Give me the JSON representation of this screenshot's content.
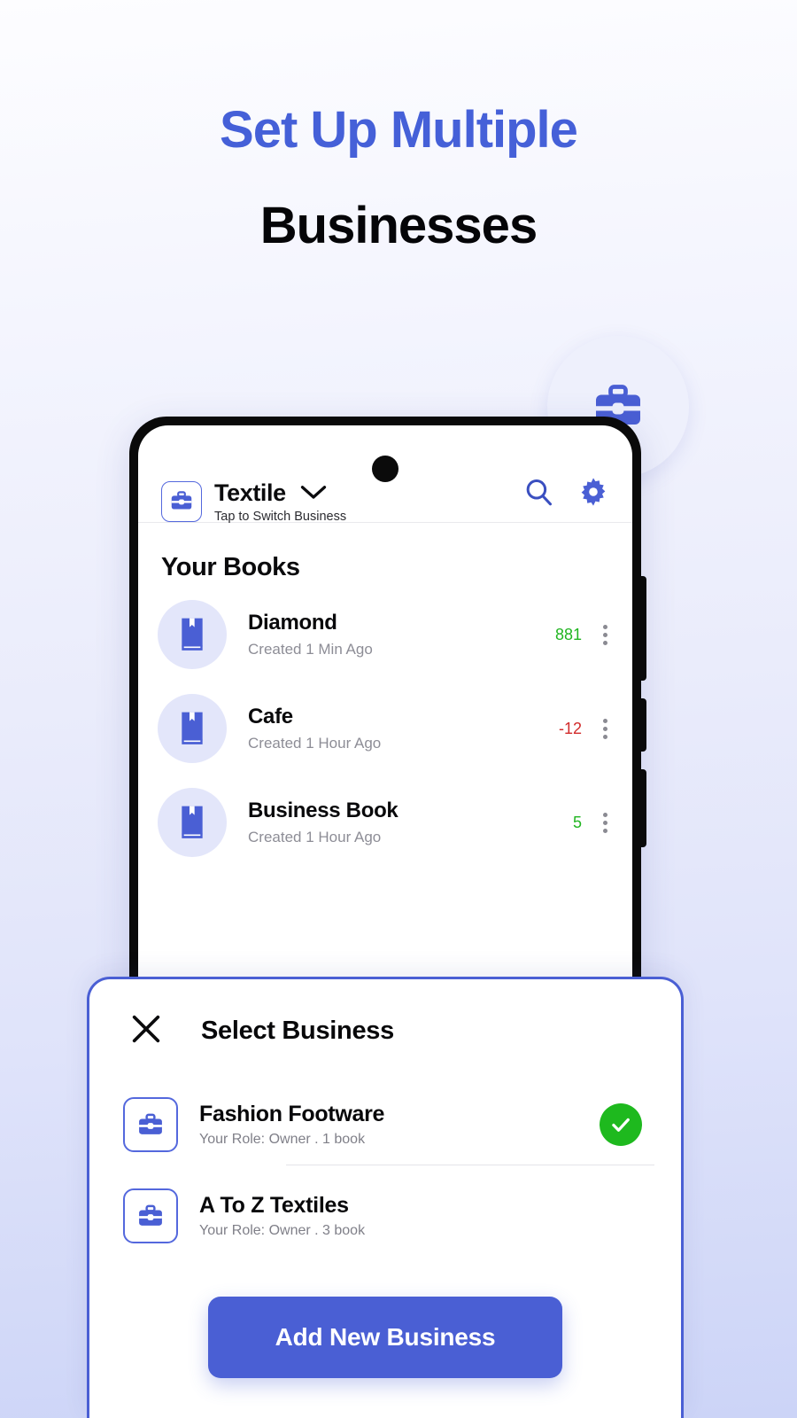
{
  "headline": {
    "line1": "Set Up Multiple",
    "line2": "Businesses",
    "accent_color": "#4560d8"
  },
  "float_badge": {
    "icon": "briefcase-icon"
  },
  "phone": {
    "app_header": {
      "logo_icon": "briefcase-icon",
      "business_name": "Textile",
      "chevron_icon": "chevron-down-icon",
      "subtitle": "Tap to Switch Business",
      "search_icon": "search-icon",
      "settings_icon": "gear-icon"
    },
    "books_section": {
      "title": "Your Books",
      "items": [
        {
          "icon": "book-icon",
          "name": "Diamond",
          "created": "Created 1 Min Ago",
          "amount": "881",
          "amount_sign": "positive",
          "menu_icon": "kebab-menu-icon"
        },
        {
          "icon": "book-icon",
          "name": "Cafe",
          "created": "Created 1 Hour Ago",
          "amount": "-12",
          "amount_sign": "negative",
          "menu_icon": "kebab-menu-icon"
        },
        {
          "icon": "book-icon",
          "name": "Business Book",
          "created": "Created 1 Hour Ago",
          "amount": "5",
          "amount_sign": "positive",
          "menu_icon": "kebab-menu-icon"
        }
      ]
    }
  },
  "sheet": {
    "close_icon": "close-icon",
    "title": "Select Business",
    "businesses": [
      {
        "icon": "briefcase-icon",
        "name": "Fashion Footware",
        "meta": "Your Role: Owner . 1 book",
        "selected": true,
        "check_icon": "check-circle-icon"
      },
      {
        "icon": "briefcase-icon",
        "name": "A To Z Textiles",
        "meta": "Your Role: Owner . 3 book",
        "selected": false
      }
    ],
    "add_button_label": "Add New Business"
  },
  "colors": {
    "accent_blue": "#4a5fd4",
    "headline_blue": "#4560d8",
    "positive_green": "#21b521",
    "negative_red": "#d22b2b",
    "check_green": "#1eb91e"
  }
}
